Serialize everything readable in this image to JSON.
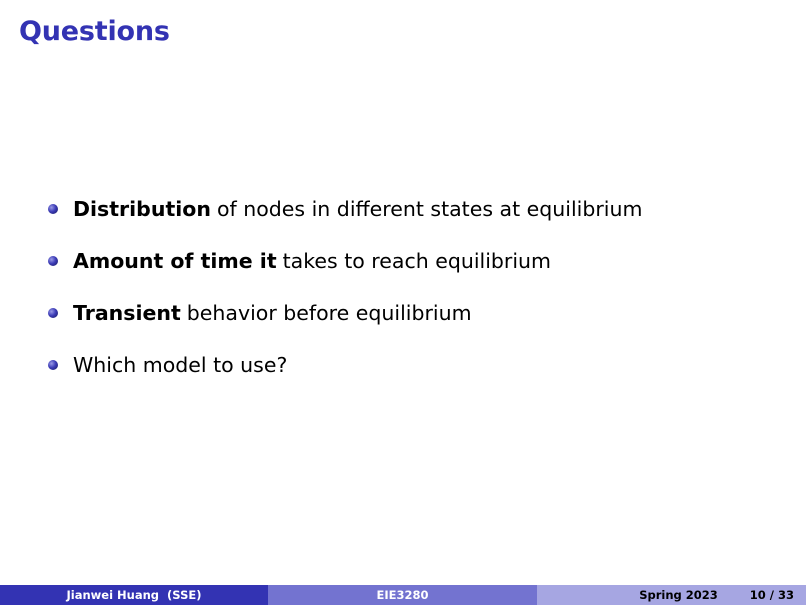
{
  "slide": {
    "title": "Questions"
  },
  "bullets": [
    {
      "bold": "Distribution",
      "text": "of nodes in different states at equilibrium"
    },
    {
      "bold": "Amount of time it",
      "text": "takes to reach equilibrium"
    },
    {
      "bold": "Transient",
      "text": "behavior before equilibrium"
    },
    {
      "bold": "",
      "text": "Which model to use?"
    }
  ],
  "footer": {
    "author": "Jianwei Huang  (SSE)",
    "course": "EIE3280",
    "date": "Spring 2023",
    "page": "10 / 33"
  },
  "colors": {
    "title": "#3333b3",
    "footer_left": "#3333b3",
    "footer_mid": "#7373d0",
    "footer_right": "#a6a6e2"
  }
}
